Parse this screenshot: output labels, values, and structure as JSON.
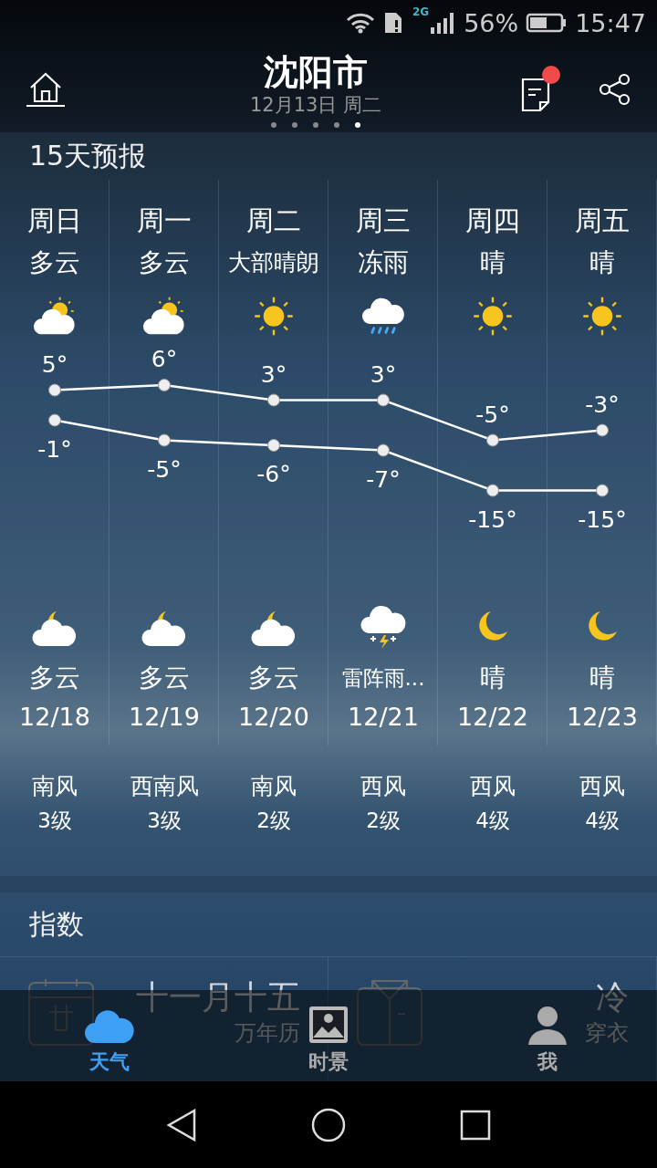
{
  "status_bar": {
    "network": "2G",
    "battery": "56%",
    "time": "15:47"
  },
  "header": {
    "city": "沈阳市",
    "date": "12月13日 周二",
    "pages": [
      {
        "selected": false
      },
      {
        "selected": false
      },
      {
        "selected": false
      },
      {
        "selected": false
      },
      {
        "selected": true
      }
    ],
    "notice_badge": true
  },
  "forecast": {
    "title": "15天预报",
    "days": [
      {
        "day": "周日",
        "daytime": {
          "condition": "多云",
          "kind": "partly_cloudy"
        },
        "night": {
          "kind": "cloudy_night",
          "condition": "多云"
        },
        "date": "12/18",
        "wind": "南风",
        "wind_level": "3级"
      },
      {
        "day": "周一",
        "daytime": {
          "condition": "多云",
          "kind": "partly_cloudy"
        },
        "night": {
          "kind": "cloudy_night",
          "condition": "多云"
        },
        "date": "12/19",
        "wind": "西南风",
        "wind_level": "3级"
      },
      {
        "day": "周二",
        "daytime": {
          "condition": "大部晴朗",
          "kind": "sunny"
        },
        "night": {
          "kind": "cloudy_night",
          "condition": "多云"
        },
        "date": "12/20",
        "wind": "南风",
        "wind_level": "2级"
      },
      {
        "day": "周三",
        "daytime": {
          "condition": "冻雨",
          "kind": "rain"
        },
        "night": {
          "kind": "thunder_snow",
          "condition": "雷阵雨..."
        },
        "date": "12/21",
        "wind": "西风",
        "wind_level": "2级"
      },
      {
        "day": "周四",
        "daytime": {
          "condition": "晴",
          "kind": "sunny"
        },
        "night": {
          "kind": "clear_night",
          "condition": "晴"
        },
        "date": "12/22",
        "wind": "西风",
        "wind_level": "4级"
      },
      {
        "day": "周五",
        "daytime": {
          "condition": "晴",
          "kind": "sunny"
        },
        "night": {
          "kind": "clear_night",
          "condition": "晴"
        },
        "date": "12/23",
        "wind": "西风",
        "wind_level": "4级"
      }
    ],
    "chart_data": {
      "type": "line",
      "series": [
        {
          "color": "#ffffff",
          "marker": "circle",
          "values": [
            5,
            6,
            3,
            3,
            -5,
            -3
          ],
          "value_labels": [
            "5°",
            "6°",
            "3°",
            "3°",
            "-5°",
            "-3°"
          ]
        },
        {
          "color": "#ffffff",
          "marker": "circle",
          "values": [
            -1,
            -5,
            -6,
            -7,
            -15,
            -15
          ],
          "value_labels": [
            "-1°",
            "-5°",
            "-6°",
            "-7°",
            "-15°",
            "-15°"
          ]
        }
      ]
    }
  },
  "indices": {
    "title": "指数",
    "items": [
      {
        "kind": "calendar",
        "value": "十一月十五",
        "label": "万年历"
      },
      {
        "kind": "clothing",
        "value": "冷",
        "label": "穿衣"
      }
    ]
  },
  "bottom_nav": [
    {
      "label": "天气",
      "kind": "weather",
      "selected": true
    },
    {
      "label": "时景",
      "kind": "scenery",
      "selected": false
    },
    {
      "label": "我",
      "kind": "me",
      "selected": false
    }
  ]
}
